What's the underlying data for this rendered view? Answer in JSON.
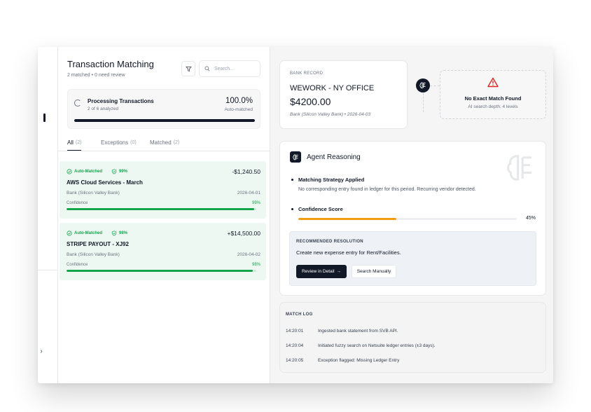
{
  "left_panel": {
    "title": "Transaction Matching",
    "subtitle": "2 matched • 0 need review",
    "search_placeholder": "Search...",
    "processing": {
      "title": "Processing Transactions",
      "subtitle": "2 of 6 analyzed",
      "percent_text": "100.0%",
      "percent_label": "Auto-matched",
      "progress": 1.0
    },
    "tabs": [
      {
        "label": "All",
        "count": "(2)"
      },
      {
        "label": "Exceptions",
        "count": "(0)"
      },
      {
        "label": "Matched",
        "count": "(2)"
      }
    ],
    "transactions": [
      {
        "status": "Auto-Matched",
        "confidence_badge": "99%",
        "amount": "-$1,240.50",
        "name": "AWS Cloud Services - March",
        "bank": "Bank (Silicon Valley Bank)",
        "date": "2026-04-01",
        "confidence_label": "Confidence",
        "confidence_text": "99%",
        "confidence": 0.99
      },
      {
        "status": "Auto-Matched",
        "confidence_badge": "98%",
        "amount": "+$14,500.00",
        "name": "STRIPE PAYOUT - XJ92",
        "bank": "Bank (Silicon Valley Bank)",
        "date": "2026-04-02",
        "confidence_label": "Confidence",
        "confidence_text": "98%",
        "confidence": 0.98
      }
    ]
  },
  "bank_record": {
    "label": "BANK RECORD",
    "name": "WEWORK - NY OFFICE",
    "amount": "$4200.00",
    "meta": "Bank (Silicon Valley Bank) • 2026-04-03"
  },
  "no_match": {
    "title": "No Exact Match Found",
    "subtitle": "AI search depth: 4 levels"
  },
  "reasoning": {
    "title": "Agent Reasoning",
    "strategy_title": "Matching Strategy Applied",
    "strategy_desc": "No corresponding entry found in ledger for this period. Recurring vendor detected.",
    "score_title": "Confidence Score",
    "score_text": "45%",
    "score": 0.45,
    "recommendation": {
      "label": "RECOMMENDED RESOLUTION",
      "desc": "Create new expense entry for Rent/Facilities.",
      "primary_button": "Review in Detail",
      "secondary_button": "Search Manually"
    }
  },
  "match_log": {
    "title": "MATCH LOG",
    "entries": [
      {
        "time": "14:20:01",
        "text": "Ingested bank statement from SVB API."
      },
      {
        "time": "14:20:04",
        "text": "Initiated fuzzy search on Netsuite ledger entries (±3 days)."
      },
      {
        "time": "14:20:05",
        "text": "Exception flagged: Missing Ledger Entry"
      }
    ]
  },
  "colors": {
    "accent_dark": "#111827",
    "success": "#16a34a",
    "success_bg": "#edf8f2",
    "warning": "#f29d13",
    "danger": "#dc2626"
  },
  "icons": [
    "filter-icon",
    "search-icon",
    "spinner-icon",
    "check-circle-icon",
    "shield-check-icon",
    "brain-icon",
    "warning-triangle-icon",
    "arrow-right-icon",
    "chevron-right-icon"
  ]
}
